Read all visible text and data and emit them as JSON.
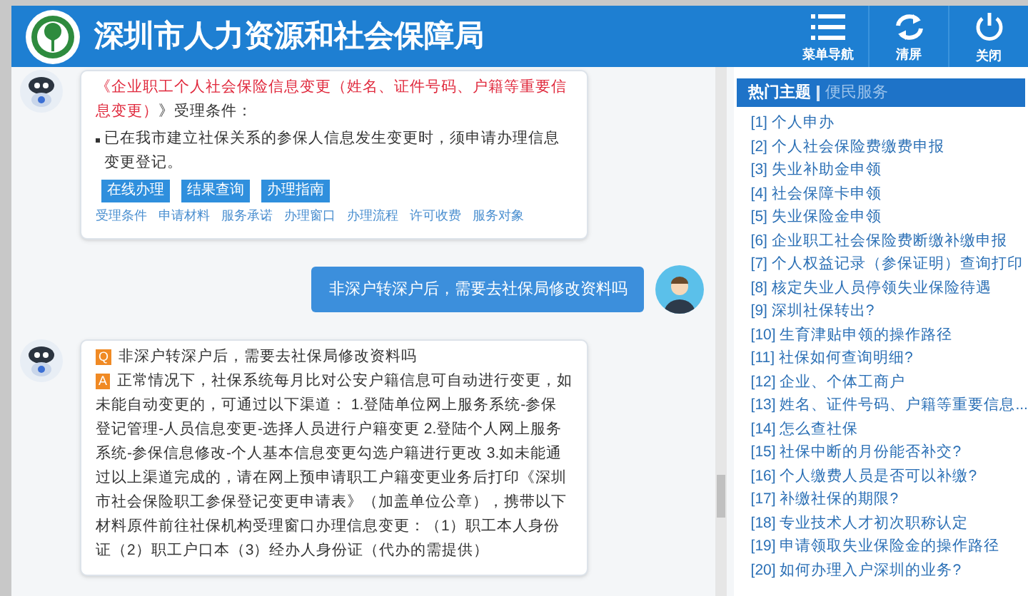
{
  "header": {
    "title": "深圳市人力资源和社会保障局",
    "buttons": [
      {
        "kind": "menu",
        "label": "菜单导航"
      },
      {
        "kind": "refresh",
        "label": "清屏"
      },
      {
        "kind": "power",
        "label": "关闭"
      }
    ]
  },
  "chat": [
    {
      "kind": "bot_card",
      "title_red": "《企业职工个人社会保险信息变更（姓名、证件号码、户籍等重要信息变更）",
      "title_rest": "》受理条件：",
      "bullet": "已在我市建立社保关系的参保人信息发生变更时，须申请办理信息变更登记。",
      "buttons": [
        "在线办理",
        "结果查询",
        "办理指南"
      ],
      "links": [
        "受理条件",
        "申请材料",
        "服务承诺",
        "办理窗口",
        "办理流程",
        "许可收费",
        "服务对象"
      ]
    },
    {
      "kind": "user",
      "text": "非深户转深户后，需要去社保局修改资料吗"
    },
    {
      "kind": "bot_answer",
      "q_mark": "Q",
      "question": "非深户转深户后，需要去社保局修改资料吗",
      "a_mark": "A",
      "answer": "正常情况下，社保系统每月比对公安户籍信息可自动进行变更，如未能自动变更的，可通过以下渠道： 1.登陆单位网上服务系统-参保登记管理-人员信息变更-选择人员进行户籍变更 2.登陆个人网上服务系统-参保信息修改-个人基本信息变更勾选户籍进行更改 3.如未能通过以上渠道完成的，请在网上预申请职工户籍变更业务后打印《深圳市社会保险职工参保登记变更申请表》（加盖单位公章），携带以下材料原件前往社保机构受理窗口办理信息变更：（1）职工本人身份证（2）职工户口本（3）经办人身份证（代办的需提供）"
    }
  ],
  "sidebar": {
    "tabs": [
      {
        "label": "热门主题",
        "selected": true
      },
      {
        "label": "便民服务",
        "selected": false
      }
    ],
    "items": [
      "[1] 个人申办",
      "[2] 个人社会保险费缴费申报",
      "[3] 失业补助金申领",
      "[4] 社会保障卡申领",
      "[5] 失业保险金申领",
      "[6] 企业职工社会保险费断缴补缴申报",
      "[7] 个人权益记录（参保证明）查询打印",
      "[8] 核定失业人员停领失业保险待遇",
      "[9] 深圳社保转出?",
      "[10] 生育津贴申领的操作路径",
      "[11] 社保如何查询明细?",
      "[12] 企业、个体工商户",
      "[13] 姓名、证件号码、户籍等重要信息...",
      "[14] 怎么查社保",
      "[15] 社保中断的月份能否补交?",
      "[16] 个人缴费人员是否可以补缴?",
      "[17] 补缴社保的期限?",
      "[18] 专业技术人才初次职称认定",
      "[19] 申请领取失业保险金的操作路径",
      "[20] 如何办理入户深圳的业务?"
    ]
  }
}
